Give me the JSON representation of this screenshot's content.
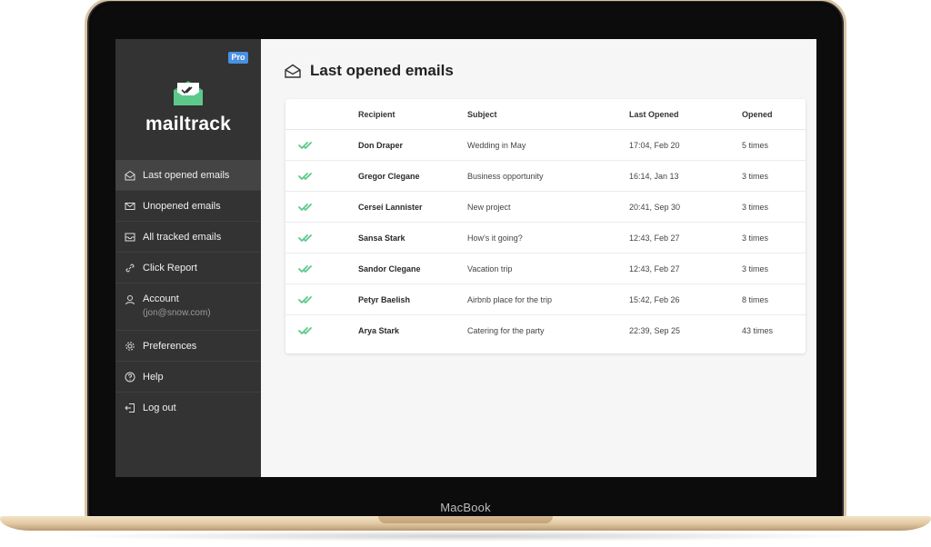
{
  "device": {
    "brand_label": "MacBook"
  },
  "app": {
    "name": "mailtrack",
    "plan_badge": "Pro"
  },
  "sidebar": {
    "items": [
      {
        "label": "Last opened emails",
        "icon": "envelope-open-icon",
        "active": true
      },
      {
        "label": "Unopened emails",
        "icon": "envelope-icon"
      },
      {
        "label": "All tracked emails",
        "icon": "inbox-icon"
      },
      {
        "label": "Click Report",
        "icon": "link-icon"
      },
      {
        "label": "Account",
        "sub": "(jon@snow.com)",
        "icon": "user-icon"
      },
      {
        "label": "Preferences",
        "icon": "gear-icon"
      },
      {
        "label": "Help",
        "icon": "help-icon"
      },
      {
        "label": "Log out",
        "icon": "logout-icon"
      }
    ]
  },
  "main": {
    "title": "Last opened emails",
    "table": {
      "headers": [
        "",
        "Recipient",
        "Subject",
        "Last Opened",
        "Opened"
      ],
      "rows": [
        {
          "recipient": "Don Draper",
          "subject": "Wedding in May",
          "last_opened": "17:04, Feb 20",
          "opened": "5 times"
        },
        {
          "recipient": "Gregor Clegane",
          "subject": "Business opportunity",
          "last_opened": "16:14, Jan 13",
          "opened": "3 times"
        },
        {
          "recipient": "Cersei Lannister",
          "subject": "New project",
          "last_opened": "20:41, Sep 30",
          "opened": "3 times"
        },
        {
          "recipient": "Sansa Stark",
          "subject": "How's it going?",
          "last_opened": "12:43, Feb 27",
          "opened": "3 times"
        },
        {
          "recipient": "Sandor Clegane",
          "subject": "Vacation trip",
          "last_opened": "12:43, Feb 27",
          "opened": "3 times"
        },
        {
          "recipient": "Petyr Baelish",
          "subject": "Airbnb place for the trip",
          "last_opened": "15:42, Feb 26",
          "opened": "8 times"
        },
        {
          "recipient": "Arya Stark",
          "subject": "Catering for the party",
          "last_opened": "22:39, Sep 25",
          "opened": "43 times"
        }
      ]
    }
  },
  "colors": {
    "accent_green": "#5cc98a",
    "badge_blue": "#4a90e2",
    "sidebar_bg": "#333333"
  }
}
